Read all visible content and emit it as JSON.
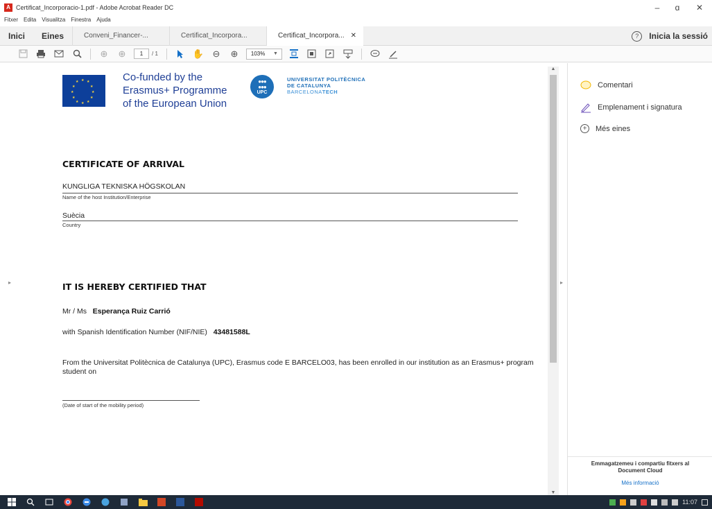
{
  "window": {
    "title": "Certificat_Incorporacio-1.pdf - Adobe Acrobat Reader DC",
    "minimize": "–",
    "maximize": "ɑ",
    "close": "✕"
  },
  "menu": [
    "Fitxer",
    "Edita",
    "Visualitza",
    "Finestra",
    "Ajuda"
  ],
  "nav": {
    "home": "Inici",
    "tools": "Eines"
  },
  "tabs": [
    {
      "label": "Conveni_Financer-...",
      "active": false
    },
    {
      "label": "Certificat_Incorpora...",
      "active": false
    },
    {
      "label": "Certificat_Incorpora...",
      "active": true
    }
  ],
  "tab_close": "✕",
  "signin": {
    "label": "Inicia la sessió",
    "help": "?"
  },
  "toolbar": {
    "page_current": "1",
    "page_total": "/ 1",
    "zoom": "103%"
  },
  "document": {
    "logo_eu_text": "Co-funded by the\nErasmus+ Programme\nof the European Union",
    "erasmus_line1": "Co-funded by the",
    "erasmus_line2": "Erasmus+ Programme",
    "erasmus_line3": "of the European Union",
    "upc_badge": "UPC",
    "upc_line1": "UNIVERSITAT POLITÈCNICA",
    "upc_line2": "DE CATALUNYA",
    "upc_line3a": "BARCELONA",
    "upc_line3b": "TECH",
    "title": "CERTIFICATE OF ARRIVAL",
    "host_institution": "KUNGLIGA TEKNISKA HÖGSKOLAN",
    "host_institution_label": "Name of the host Institution/Enterprise",
    "country": "Suècia",
    "country_label": "Country",
    "certified_heading": "IT IS HEREBY CERTIFIED THAT",
    "person_prefix": "Mr / Ms",
    "person_name": "Esperança Ruiz Carrió",
    "id_prefix": "with Spanish Identification Number (NIF/NIE)",
    "id_number": "43481588L",
    "paragraph": "From the Universitat Politècnica de Catalunya (UPC), Erasmus code E BARCELO03, has been enrolled in our institution as an Erasmus+ program student on",
    "date_label": "(Date of start of the mobility period)"
  },
  "panel": {
    "comment": "Comentari",
    "fill_sign": "Emplenament i signatura",
    "more_tools": "Més eines",
    "cloud_text_1": "Emmagatzemeu i compartiu fitxers al",
    "cloud_text_2": "Document Cloud",
    "cloud_link": "Més informació"
  },
  "taskbar": {
    "clock": "11:07"
  },
  "colors": {
    "accent": "#1470c8",
    "eu_blue": "#0d3f9a",
    "upc_blue": "#1e6fb8",
    "taskbar": "#1e2a38"
  }
}
